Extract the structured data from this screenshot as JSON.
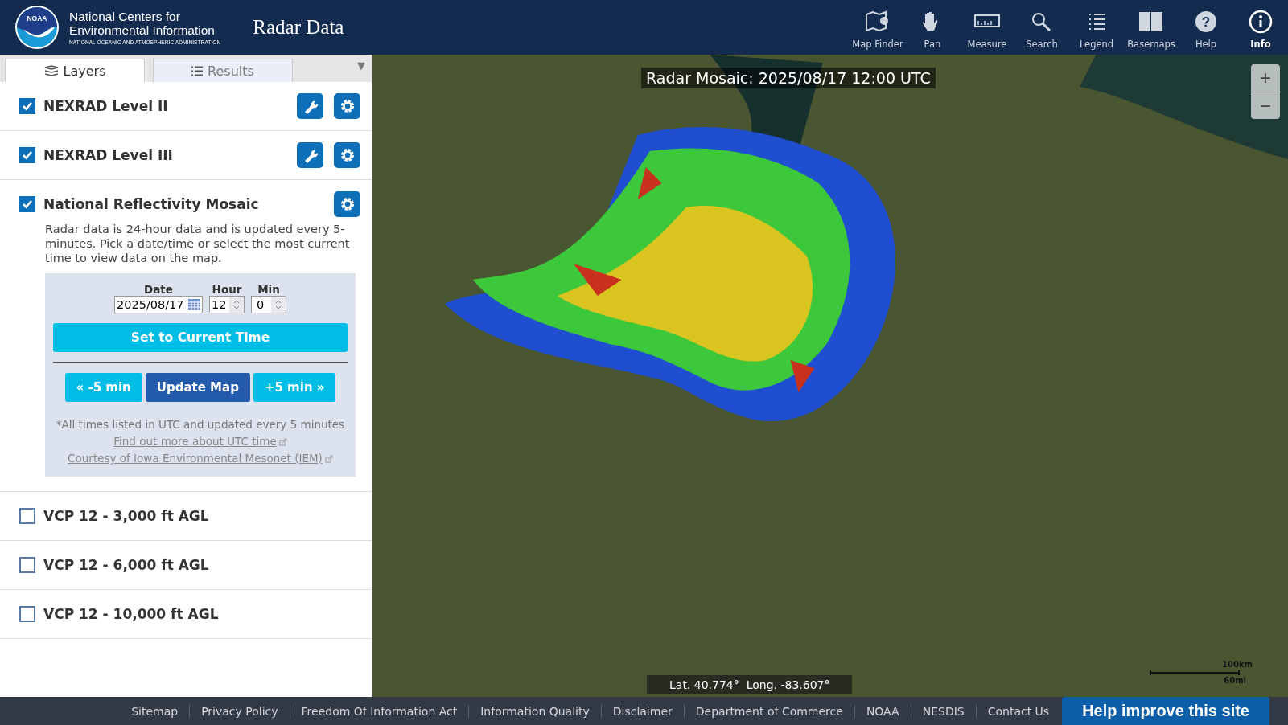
{
  "header": {
    "org_name_line1": "National Centers for",
    "org_name_line2": "Environmental Information",
    "org_subtitle": "NATIONAL OCEANIC AND ATMOSPHERIC ADMINISTRATION",
    "logo_text": "NOAA",
    "app_title": "Radar Data",
    "tools": [
      {
        "kind": "map-finder",
        "label": "Map Finder"
      },
      {
        "kind": "pan",
        "label": "Pan"
      },
      {
        "kind": "measure",
        "label": "Measure"
      },
      {
        "kind": "search",
        "label": "Search"
      },
      {
        "kind": "legend",
        "label": "Legend"
      },
      {
        "kind": "basemaps",
        "label": "Basemaps"
      },
      {
        "kind": "help",
        "label": "Help",
        "glyph": "?"
      },
      {
        "kind": "info",
        "label": "Info"
      }
    ]
  },
  "sidebar": {
    "tabs": [
      {
        "label": "Layers",
        "kind": "layers",
        "selected": true
      },
      {
        "label": "Results",
        "kind": "results",
        "selected": false
      }
    ],
    "collapse_icon": "▼",
    "layers": [
      {
        "name": "NEXRAD Level II",
        "checked": true,
        "wrench_button": true,
        "settings_button": true
      },
      {
        "name": "NEXRAD Level III",
        "checked": true,
        "wrench_button": true,
        "settings_button": true
      },
      {
        "name": "National Reflectivity Mosaic",
        "checked": true,
        "settings_button": true,
        "description": "Radar data is 24-hour data and is updated every 5-minutes. Pick a date/time or select the most current time to view data on the map.",
        "time_panel": {
          "date_label": "Date",
          "date": "2025/08/17",
          "hour_label": "Hour",
          "hour": "12",
          "min_label": "Min",
          "min": "0",
          "set_current": "Set to Current Time",
          "prev": "« -5 min",
          "update": "Update Map",
          "next": "+5 min »",
          "note": "*All times listed in UTC and updated every 5 minutes",
          "links": [
            "Find out more about UTC time",
            "Courtesy of Iowa Environmental Mesonet (IEM)"
          ]
        }
      },
      {
        "name": "VCP 12 - 3,000 ft AGL",
        "checked": false
      },
      {
        "name": "VCP 12 - 6,000 ft AGL",
        "checked": false
      },
      {
        "name": "VCP 12 - 10,000 ft AGL",
        "checked": false
      }
    ]
  },
  "map": {
    "title": "Radar Mosaic: 2025/08/17 12:00 UTC",
    "zoom_in": "+",
    "zoom_out": "−",
    "coordinates": "Lat. 40.774°  Long. -83.607°",
    "scale_km": "100km",
    "scale_mi": "60mi"
  },
  "footer": {
    "links": [
      "Sitemap",
      "Privacy Policy",
      "Freedom Of Information Act",
      "Information Quality",
      "Disclaimer",
      "Department of Commerce",
      "NOAA",
      "NESDIS",
      "Contact Us"
    ],
    "feedback_button": "Help improve this site"
  }
}
